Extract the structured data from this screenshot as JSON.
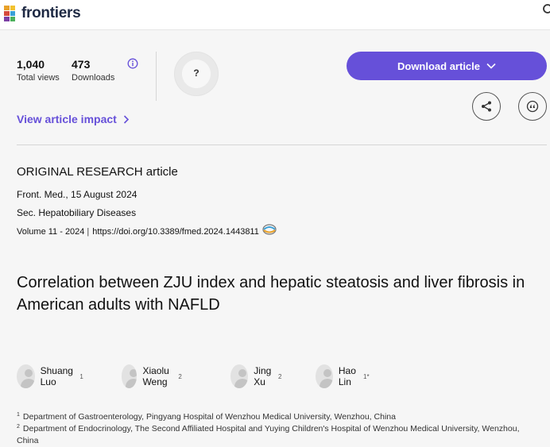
{
  "header": {
    "logo_text": "frontiers"
  },
  "metrics": {
    "views_value": "1,040",
    "views_label": "Total views",
    "downloads_value": "473",
    "downloads_label": "Downloads"
  },
  "badge": {
    "text": "?"
  },
  "actions": {
    "download_label": "Download article",
    "impact_label": "View article impact"
  },
  "article": {
    "type": "ORIGINAL RESEARCH article",
    "journal_date": "Front. Med., 15 August 2024",
    "section": "Sec. Hepatobiliary Diseases",
    "volume": "Volume 11 - 2024",
    "doi": "https://doi.org/10.3389/fmed.2024.1443811",
    "title": "Correlation between ZJU index and hepatic steatosis and liver fibrosis in American adults with NAFLD"
  },
  "authors": [
    {
      "name": "Shuang Luo",
      "sup": "1"
    },
    {
      "name": "Xiaolu Weng",
      "sup": "2"
    },
    {
      "name": "Jing Xu",
      "sup": "2"
    },
    {
      "name": "Hao Lin",
      "sup": "1*"
    }
  ],
  "affiliations": [
    {
      "num": "1",
      "text": "Department of Gastroenterology, Pingyang Hospital of Wenzhou Medical University, Wenzhou, China"
    },
    {
      "num": "2",
      "text": "Department of Endocrinology, The Second Affiliated Hospital and Yuying Children's Hospital of Wenzhou Medical University, Wenzhou, China"
    }
  ],
  "colors": {
    "accent": "#6650d9",
    "background": "#f6f6f6"
  },
  "icons": [
    "frontiers-logo-icon",
    "search-icon",
    "info-icon",
    "chevron-down-icon",
    "share-icon",
    "cite-icon",
    "chevron-right-icon",
    "crossmark-icon",
    "avatar-icon"
  ]
}
